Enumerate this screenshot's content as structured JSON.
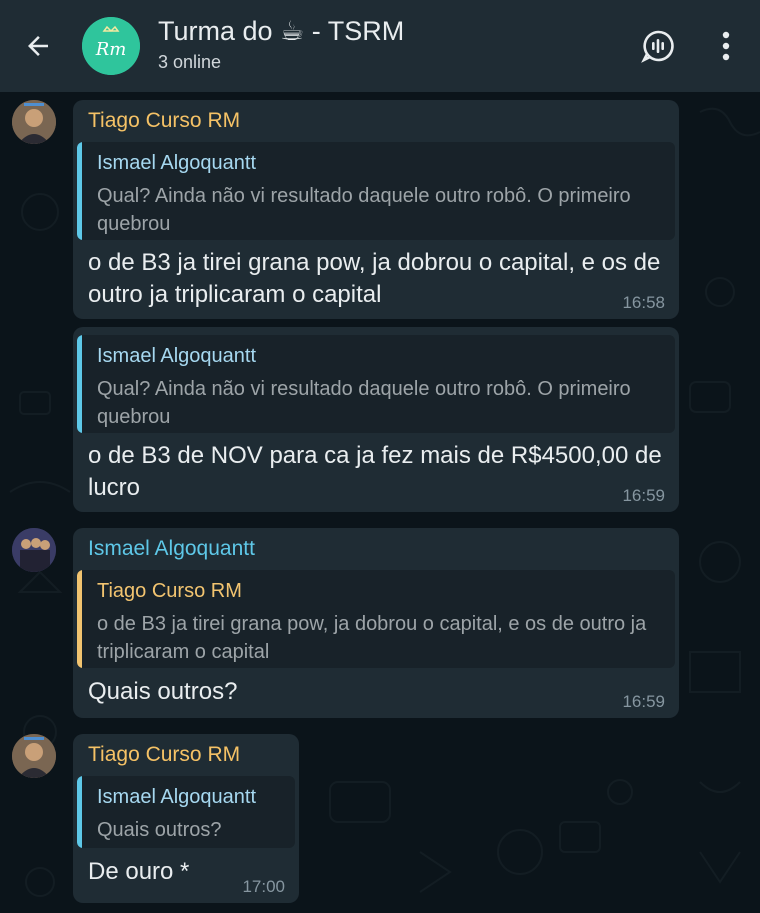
{
  "header": {
    "title": "Turma do ☕ - TSRM",
    "subtitle": "3 online",
    "avatar_text": "Rm"
  },
  "colors": {
    "header_bg": "#1f2c34",
    "chat_bg": "#0b141a",
    "bubble_bg": "#1f2c34",
    "quote_bg": "#182229",
    "tiago_color": "#f5c266",
    "ismael_color": "#5ec8e8",
    "ismael_quote_color": "#a6d8f0",
    "tiago_quote_color": "#f2c470"
  },
  "messages": [
    {
      "sender": "Tiago Curso RM",
      "quote_name": "Ismael Algoquantt",
      "quote_text": "Qual? Ainda não vi resultado daquele outro robô. O primeiro quebrou",
      "text": "o de B3 ja tirei grana pow, ja dobrou o capital, e os de outro ja triplicaram o capital",
      "time": "16:58"
    },
    {
      "sender": "",
      "quote_name": "Ismael Algoquantt",
      "quote_text": "Qual? Ainda não vi resultado daquele outro robô. O primeiro quebrou",
      "text": "o de B3 de NOV para ca ja fez mais de R$4500,00 de lucro",
      "time": "16:59"
    },
    {
      "sender": "Ismael Algoquantt",
      "quote_name": "Tiago Curso RM",
      "quote_text": "o de B3 ja tirei grana pow, ja dobrou o capital, e os de outro ja triplicaram o capital",
      "text": "Quais outros?",
      "time": "16:59"
    },
    {
      "sender": "Tiago Curso RM",
      "quote_name": "Ismael Algoquantt",
      "quote_text": "Quais outros?",
      "text": "De ouro *",
      "time": "17:00"
    }
  ]
}
